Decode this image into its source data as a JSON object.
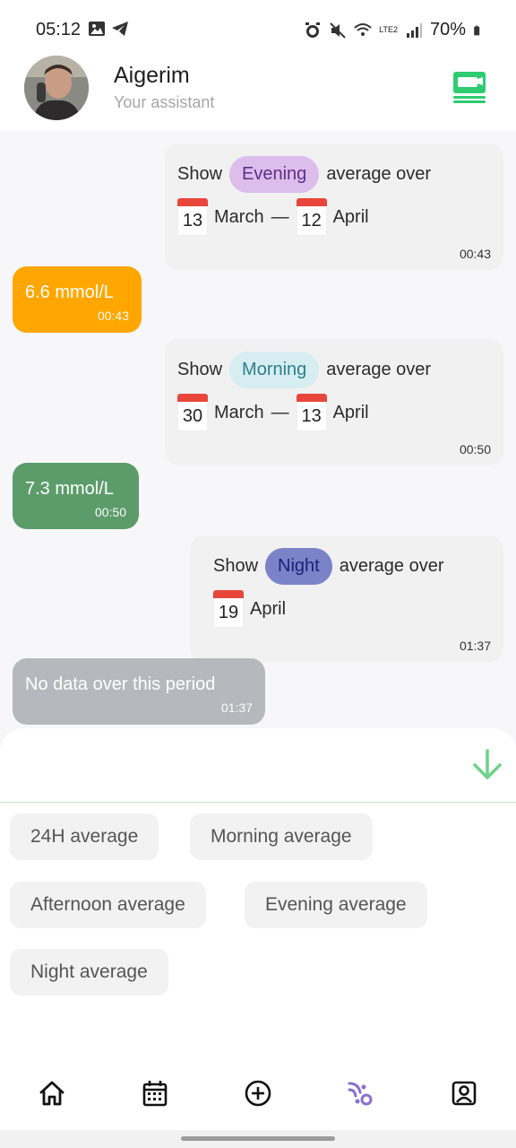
{
  "status": {
    "time": "05:12",
    "battery": "70%",
    "network": "LTE2",
    "left_icons": [
      "image-icon",
      "telegram-icon"
    ],
    "right_icons": [
      "alarm-icon",
      "mute-icon",
      "wifi-icon",
      "signal-icon",
      "battery-icon"
    ]
  },
  "header": {
    "name": "Aigerim",
    "subtitle": "Your assistant",
    "accent": "#2ecc71"
  },
  "messages": [
    {
      "type": "user",
      "show": "Show",
      "chip": "Evening",
      "suffix": "average over",
      "d1": "13",
      "m1": "March",
      "dash": "—",
      "d2": "12",
      "m2": "April",
      "time": "00:43"
    },
    {
      "type": "bot",
      "text": "6.6 mmol/L",
      "time": "00:43",
      "color": "#ffa600"
    },
    {
      "type": "user",
      "show": "Show",
      "chip": "Morning",
      "suffix": "average over",
      "d1": "30",
      "m1": "March",
      "dash": "—",
      "d2": "13",
      "m2": "April",
      "time": "00:50"
    },
    {
      "type": "bot",
      "text": "7.3 mmol/L",
      "time": "00:50",
      "color": "#5c9c6a"
    },
    {
      "type": "user",
      "show": "Show",
      "chip": "Night",
      "suffix": "average over",
      "d1": "19",
      "m1": "April",
      "time": "01:37"
    },
    {
      "type": "bot",
      "text": "No data over this period",
      "time": "01:37",
      "color": "#b5b8bd"
    }
  ],
  "quick_actions": [
    "24H average",
    "Morning average",
    "Afternoon average",
    "Evening average",
    "Night average"
  ],
  "nav": [
    "home-icon",
    "calendar-icon",
    "add-circle-icon",
    "chat-assistant-icon",
    "profile-icon"
  ],
  "colors": {
    "evening": "#dcbdec",
    "morning": "#d6edf1",
    "night": "#7a83c8",
    "active_nav": "#8a6fd1",
    "green": "#6fd18a"
  }
}
